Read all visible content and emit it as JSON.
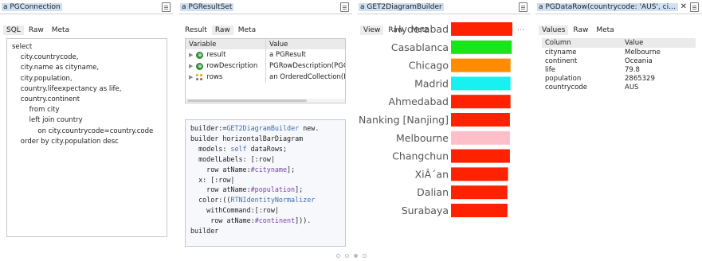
{
  "panes": [
    {
      "title": "a PGConnection",
      "tabs": [
        "SQL",
        "Raw",
        "Meta"
      ],
      "sql_lines": [
        "select",
        "    city.countrycode,",
        "    city.name as cityname,",
        "    city.population,",
        "    country.lifeexpectancy as life,",
        "    country.continent",
        "        from city",
        "        left join country",
        "            on city.countrycode=country.code",
        "    order by city.population desc"
      ]
    },
    {
      "title": "a PGResultSet",
      "tabs": [
        "Result",
        "Raw",
        "Meta"
      ],
      "columns": [
        "Variable",
        "Value"
      ],
      "rows": [
        {
          "icon": "instance-variable-icon",
          "name": "result",
          "value": "a PGResult"
        },
        {
          "icon": "instance-variable-icon",
          "name": "rowDescription",
          "value": "PGRowDescription(PGC"
        },
        {
          "icon": "collection-icon",
          "name": "rows",
          "value": "an OrderedCollection(P"
        }
      ],
      "code_lines": [
        [
          {
            "t": "builder:=",
            "c": ""
          },
          {
            "t": "GET2DiagramBuilder",
            "c": "cls"
          },
          {
            "t": " new.",
            "c": ""
          }
        ],
        [
          {
            "t": "builder horizontalBarDiagram",
            "c": ""
          }
        ],
        [
          {
            "t": "  models: ",
            "c": ""
          },
          {
            "t": "self",
            "c": "kw"
          },
          {
            "t": " dataRows;",
            "c": ""
          }
        ],
        [
          {
            "t": "  modelLabels: [:row|",
            "c": ""
          }
        ],
        [
          {
            "t": "    row atName:",
            "c": ""
          },
          {
            "t": "#cityname",
            "c": "sym"
          },
          {
            "t": "];",
            "c": ""
          }
        ],
        [
          {
            "t": "  x: [:row|",
            "c": ""
          }
        ],
        [
          {
            "t": "    row atName:",
            "c": ""
          },
          {
            "t": "#population",
            "c": "sym"
          },
          {
            "t": "];",
            "c": ""
          }
        ],
        [
          {
            "t": "  color:((",
            "c": ""
          },
          {
            "t": "RTNIdentityNormalizer",
            "c": "cls"
          }
        ],
        [
          {
            "t": "    withCommand:[:row|",
            "c": ""
          }
        ],
        [
          {
            "t": "     row atName:",
            "c": ""
          },
          {
            "t": "#continent",
            "c": "sym"
          },
          {
            "t": "])).",
            "c": ""
          }
        ],
        [
          {
            "t": "builder",
            "c": ""
          }
        ]
      ]
    },
    {
      "title": "a GET2DiagramBuilder",
      "tabs": [
        "View",
        "Raw",
        "Meta"
      ],
      "tools": [
        "zoom-out-icon",
        "zoom-in-icon",
        "more-icon"
      ],
      "tool_glyphs": [
        "⊖",
        "⊕",
        "⋯"
      ]
    },
    {
      "title": "a PGDataRow(countrycode: 'AUS', citynam...",
      "tabs": [
        "Values",
        "Raw",
        "Meta"
      ],
      "columns": [
        "Column",
        "Value"
      ],
      "rows": [
        {
          "name": "cityname",
          "value": "Melbourne"
        },
        {
          "name": "continent",
          "value": "Oceania"
        },
        {
          "name": "life",
          "value": "79.8"
        },
        {
          "name": "population",
          "value": "2865329"
        },
        {
          "name": "countrycode",
          "value": "AUS"
        }
      ]
    }
  ],
  "chart_data": {
    "type": "bar",
    "orientation": "horizontal",
    "categories": [
      "Hyderabad",
      "Casablanca",
      "Chicago",
      "Madrid",
      "Ahmedabad",
      "Nanking [Nanjing]",
      "Melbourne",
      "Changchun",
      "XiÂ´an",
      "Dalian",
      "Surabaya"
    ],
    "values": [
      10.0,
      9.9,
      9.7,
      9.7,
      9.7,
      9.6,
      9.6,
      9.6,
      9.3,
      9.2,
      9.2
    ],
    "colors": [
      "#ff2200",
      "#19e619",
      "#ff8c00",
      "#19f0f0",
      "#ff2200",
      "#ff2200",
      "#ffbfc8",
      "#ff2200",
      "#ff2200",
      "#ff2200",
      "#ff2200"
    ],
    "xlim": [
      0,
      10
    ],
    "axes": false,
    "grid": false
  },
  "pager": {
    "count": 4,
    "active": 2
  }
}
